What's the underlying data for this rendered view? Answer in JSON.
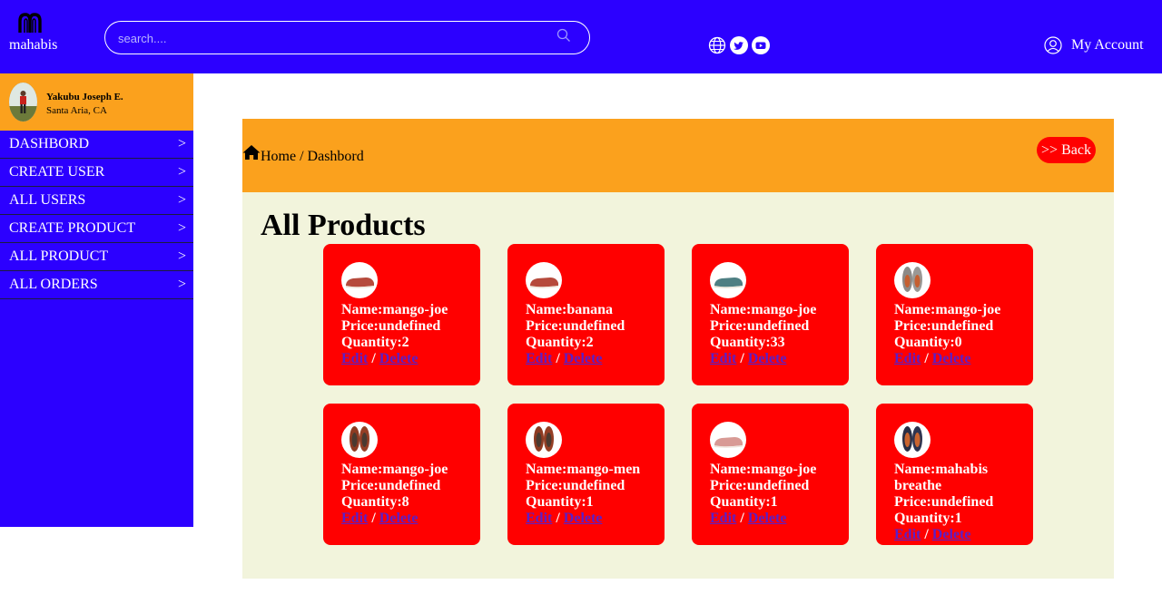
{
  "header": {
    "brand": "mahabis",
    "search_placeholder": "search....",
    "account_label": "My Account",
    "social_icons": [
      "globe-icon",
      "twitter-icon",
      "youtube-icon"
    ],
    "colors": {
      "primary": "#2c00ff",
      "accent": "#fba11d",
      "card": "#ff0000",
      "panel": "#f2f4dc"
    }
  },
  "sidebar": {
    "profile": {
      "name": "Yakubu Joseph E.",
      "location": "Santa Aria, CA"
    },
    "items": [
      {
        "label": "DASHBORD",
        "arrow": ">"
      },
      {
        "label": "CREATE USER",
        "arrow": ">"
      },
      {
        "label": "ALL USERS",
        "arrow": ">"
      },
      {
        "label": "CREATE PRODUCT",
        "arrow": ">"
      },
      {
        "label": "ALL PRODUCT",
        "arrow": ">"
      },
      {
        "label": "ALL ORDERS",
        "arrow": ">"
      }
    ]
  },
  "main": {
    "breadcrumb": "Home / Dashbord",
    "back_label": ">> Back",
    "title": "All Products",
    "edit_label": "Edit",
    "separator": " / ",
    "delete_label": "Delete",
    "products": [
      {
        "name": "Name:mango-joe",
        "price": "Price:undefined",
        "quantity": "Quantity:2",
        "shoe": "red"
      },
      {
        "name": "Name:banana",
        "price": "Price:undefined",
        "quantity": "Quantity:2",
        "shoe": "red"
      },
      {
        "name": "Name:mango-joe",
        "price": "Price:undefined",
        "quantity": "Quantity:33",
        "shoe": "teal"
      },
      {
        "name": "Name:mango-joe",
        "price": "Price:undefined",
        "quantity": "Quantity:0",
        "shoe": "grey-pair"
      },
      {
        "name": "Name:mango-joe",
        "price": "Price:undefined",
        "quantity": "Quantity:8",
        "shoe": "brown-pair"
      },
      {
        "name": "Name:mango-men",
        "price": "Price:undefined",
        "quantity": "Quantity:1",
        "shoe": "brown-pair"
      },
      {
        "name": "Name:mango-joe",
        "price": "Price:undefined",
        "quantity": "Quantity:1",
        "shoe": "pink"
      },
      {
        "name": "Name:mahabis breathe",
        "price": "Price:undefined",
        "quantity": "Quantity:1",
        "shoe": "navy-pair"
      }
    ]
  }
}
